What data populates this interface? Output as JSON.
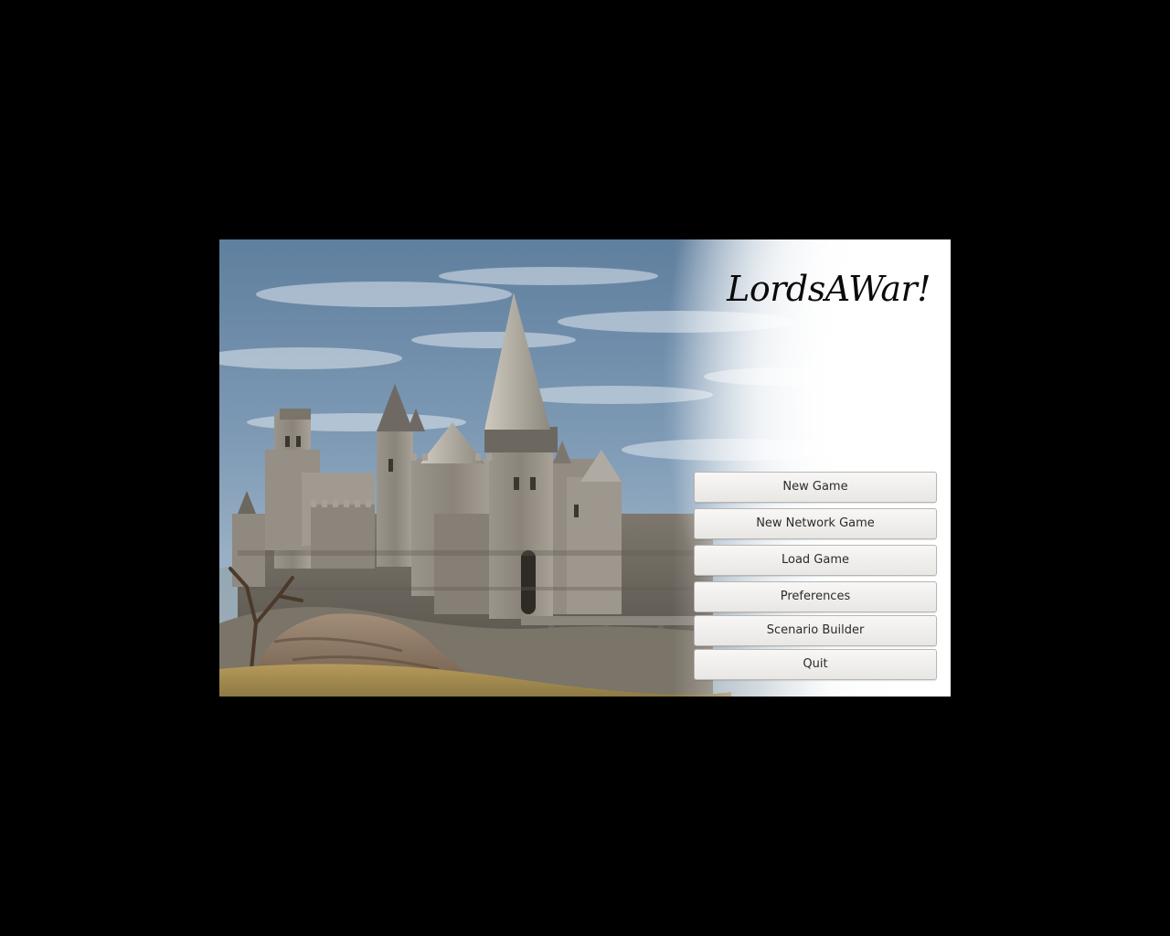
{
  "app": {
    "title": "LordsAWar!"
  },
  "menu": {
    "items": [
      {
        "label": "New Game"
      },
      {
        "label": "New Network Game"
      },
      {
        "label": "Load Game"
      },
      {
        "label": "Preferences"
      },
      {
        "label": "Scenario Builder"
      },
      {
        "label": "Quit"
      }
    ]
  },
  "colors": {
    "background": "#000000",
    "sky": "#6f8eaa",
    "stone": "#8f8a82",
    "title_text": "#0a0a0a",
    "button_face": "#f2f1f0",
    "button_text": "#2b2b2b"
  }
}
